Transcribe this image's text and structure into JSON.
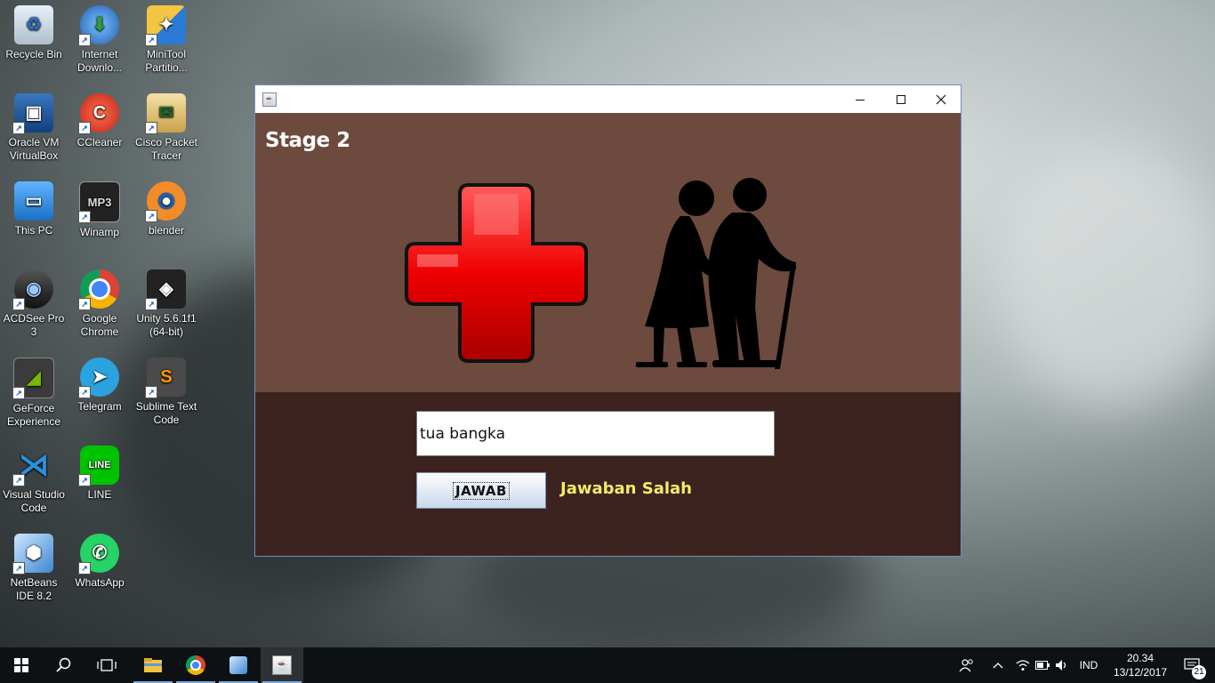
{
  "desktop": {
    "icons": [
      {
        "label": "Recycle Bin",
        "icon": "recycle-bin-icon"
      },
      {
        "label": "Internet Downlo...",
        "icon": "idm-icon"
      },
      {
        "label": "MiniTool Partitio...",
        "icon": "minitool-icon"
      },
      {
        "label": "Oracle VM VirtualBox",
        "icon": "virtualbox-icon"
      },
      {
        "label": "CCleaner",
        "icon": "ccleaner-icon"
      },
      {
        "label": "Cisco Packet Tracer",
        "icon": "packet-tracer-icon"
      },
      {
        "label": "This PC",
        "icon": "computer-icon"
      },
      {
        "label": "Winamp",
        "icon": "winamp-icon"
      },
      {
        "label": "blender",
        "icon": "blender-icon"
      },
      {
        "label": "ACDSee Pro 3",
        "icon": "acdsee-icon"
      },
      {
        "label": "Google Chrome",
        "icon": "chrome-icon"
      },
      {
        "label": "Unity 5.6.1f1 (64-bit)",
        "icon": "unity-icon"
      },
      {
        "label": "GeForce Experience",
        "icon": "geforce-icon"
      },
      {
        "label": "Telegram",
        "icon": "telegram-icon"
      },
      {
        "label": "Sublime Text Code",
        "icon": "sublime-icon"
      },
      {
        "label": "Visual Studio Code",
        "icon": "vscode-icon"
      },
      {
        "label": "LINE",
        "icon": "line-icon"
      },
      {
        "label": "NetBeans IDE 8.2",
        "icon": "netbeans-icon"
      },
      {
        "label": "WhatsApp",
        "icon": "whatsapp-icon"
      }
    ]
  },
  "window": {
    "title": "",
    "stage_title": "Stage 2",
    "answer_value": "tua bangka",
    "submit_label": "JAWAB",
    "result_text": "Jawaban Salah",
    "colors": {
      "top_panel": "#6c4a3e",
      "bottom_panel": "#3d2320",
      "result": "#f4ea6a"
    }
  },
  "taskbar": {
    "language": "IND",
    "time": "20.34",
    "date": "13/12/2017",
    "notifications": "21"
  }
}
